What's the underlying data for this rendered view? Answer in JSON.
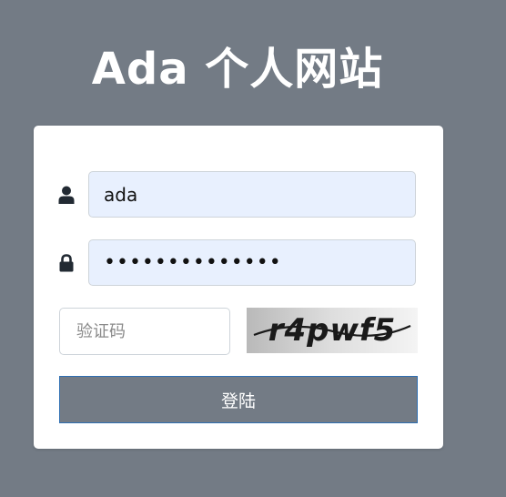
{
  "header": {
    "title": "Ada 个人网站"
  },
  "login_form": {
    "username": {
      "icon": "user-icon",
      "value": "ada"
    },
    "password": {
      "icon": "lock-icon",
      "value": "••••••••••••••"
    },
    "captcha": {
      "placeholder": "验证码",
      "image_text": "r4pwf5"
    },
    "submit_label": "登陆"
  },
  "colors": {
    "page_background": "#737b85",
    "card_background": "#ffffff",
    "input_autofill": "#e8f0fe",
    "button_background": "#737b85",
    "button_border": "#2f6fb2"
  }
}
